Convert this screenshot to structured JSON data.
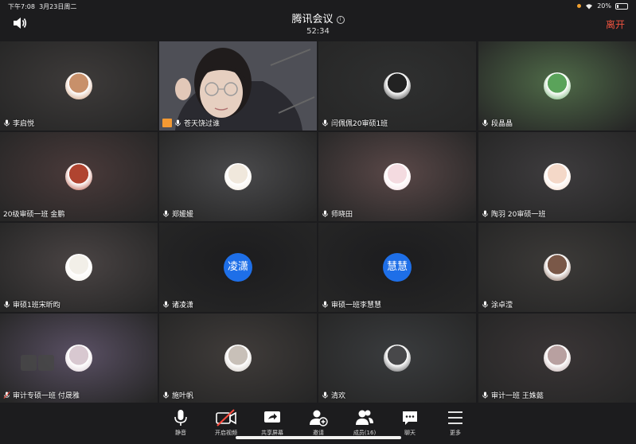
{
  "status": {
    "time": "下午7:08",
    "date": "3月23日周二",
    "battery": "20%",
    "battery_level": 0.2
  },
  "header": {
    "title": "腾讯会议",
    "duration": "52:34",
    "leave_label": "离开"
  },
  "participants": [
    {
      "name": "李启悦",
      "bg": "#3e3b3a",
      "avatar_color": "#c8906a"
    },
    {
      "name": "苍天饶过谁",
      "bg": "#6f7078",
      "video": true,
      "active": true
    },
    {
      "name": "闫佩佩20审硕1班",
      "bg": "#2f3030",
      "avatar_color": "#222222"
    },
    {
      "name": "段晶晶",
      "bg": "#4f6a48",
      "avatar_color": "#5aa35a"
    },
    {
      "name": "20级审硕一班 金鹏",
      "bg": "#4a3a3a",
      "avatar_color": "#b04430",
      "no_mic": true
    },
    {
      "name": "郑媛媛",
      "bg": "#4a4a4c",
      "avatar_color": "#f0e8dc"
    },
    {
      "name": "师晓田",
      "bg": "#5a4848",
      "avatar_color": "#f4dbe0"
    },
    {
      "name": "陶羽  20审硕一班",
      "bg": "#3e3c3e",
      "avatar_color": "#f4d8c8"
    },
    {
      "name": "审硕1班宋昕昀",
      "bg": "#4a4444",
      "avatar_color": "#f2efe8"
    },
    {
      "name": "诸凌潇",
      "bg": "#1c1c1e",
      "initials": "凌潇"
    },
    {
      "name": "审硕一班李慧慧",
      "bg": "#1c1c1e",
      "initials": "慧慧"
    },
    {
      "name": "涂卓滢",
      "bg": "#3c3a38",
      "avatar_color": "#7a5848"
    },
    {
      "name": "审计专硕一班 付晟雅",
      "bg": "#5a5064",
      "avatar_color": "#d8c8d0",
      "muted": true,
      "hover_controls": true
    },
    {
      "name": "施叶帆",
      "bg": "#403c3a",
      "avatar_color": "#c8c0b8"
    },
    {
      "name": "清欢",
      "bg": "#3a3c3e",
      "avatar_color": "#48484a"
    },
    {
      "name": "审计一班 王姝懿",
      "bg": "#3a3536",
      "avatar_color": "#b8a0a0"
    }
  ],
  "toolbar": {
    "mute_label": "静音",
    "video_label": "开启视频",
    "share_label": "共享屏幕",
    "invite_label": "邀请",
    "members_label": "成员(16)",
    "chat_label": "聊天",
    "more_label": "更多"
  }
}
